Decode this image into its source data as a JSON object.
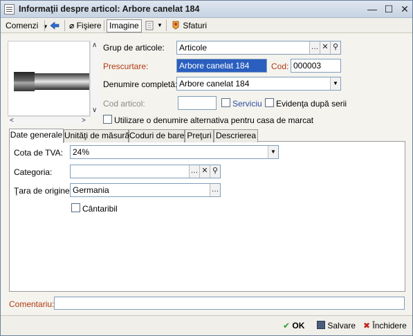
{
  "window": {
    "title": "Informaţii despre articol: Arbore canelat 184",
    "minimize": "—",
    "maximize": "☐",
    "close": "✕"
  },
  "toolbar": {
    "comenzi": "Comenzi",
    "fisiere": "Fişiere",
    "imagine": "Imagine",
    "sfaturi": "Sfaturi"
  },
  "form": {
    "grup_label": "Grup de articole:",
    "grup_value": "Articole",
    "prescurtare_label": "Prescurtare:",
    "prescurtare_value": "Arbore canelat 184",
    "cod_label": "Cod:",
    "cod_value": "000003",
    "denumire_label": "Denumire completă:",
    "denumire_value": "Arbore canelat 184",
    "cod_articol_label": "Cod articol:",
    "cod_articol_value": "",
    "serviciu_label": "Serviciu",
    "evidenta_label": "Evidenţa după serii",
    "alt_name_label": "Utilizare o denumire alternativa pentru casa de marcat"
  },
  "tabs": [
    {
      "label": "Date generale"
    },
    {
      "label": "Unităţi de măsură"
    },
    {
      "label": "Coduri de bare"
    },
    {
      "label": "Preţuri"
    },
    {
      "label": "Descrierea"
    }
  ],
  "general": {
    "tva_label": "Cota de TVA:",
    "tva_value": "24%",
    "categoria_label": "Categoria:",
    "categoria_value": "",
    "tara_label": "Ţara de origine:",
    "tara_value": "Germania",
    "cantaribil_label": "Cântaribil"
  },
  "comentariu_label": "Comentariu:",
  "comentariu_value": "",
  "footer": {
    "ok": "OK",
    "salvare": "Salvare",
    "inchidere": "Închidere"
  },
  "colors": {
    "accent_red": "#b23a12",
    "selection_blue": "#2a5fbf"
  }
}
